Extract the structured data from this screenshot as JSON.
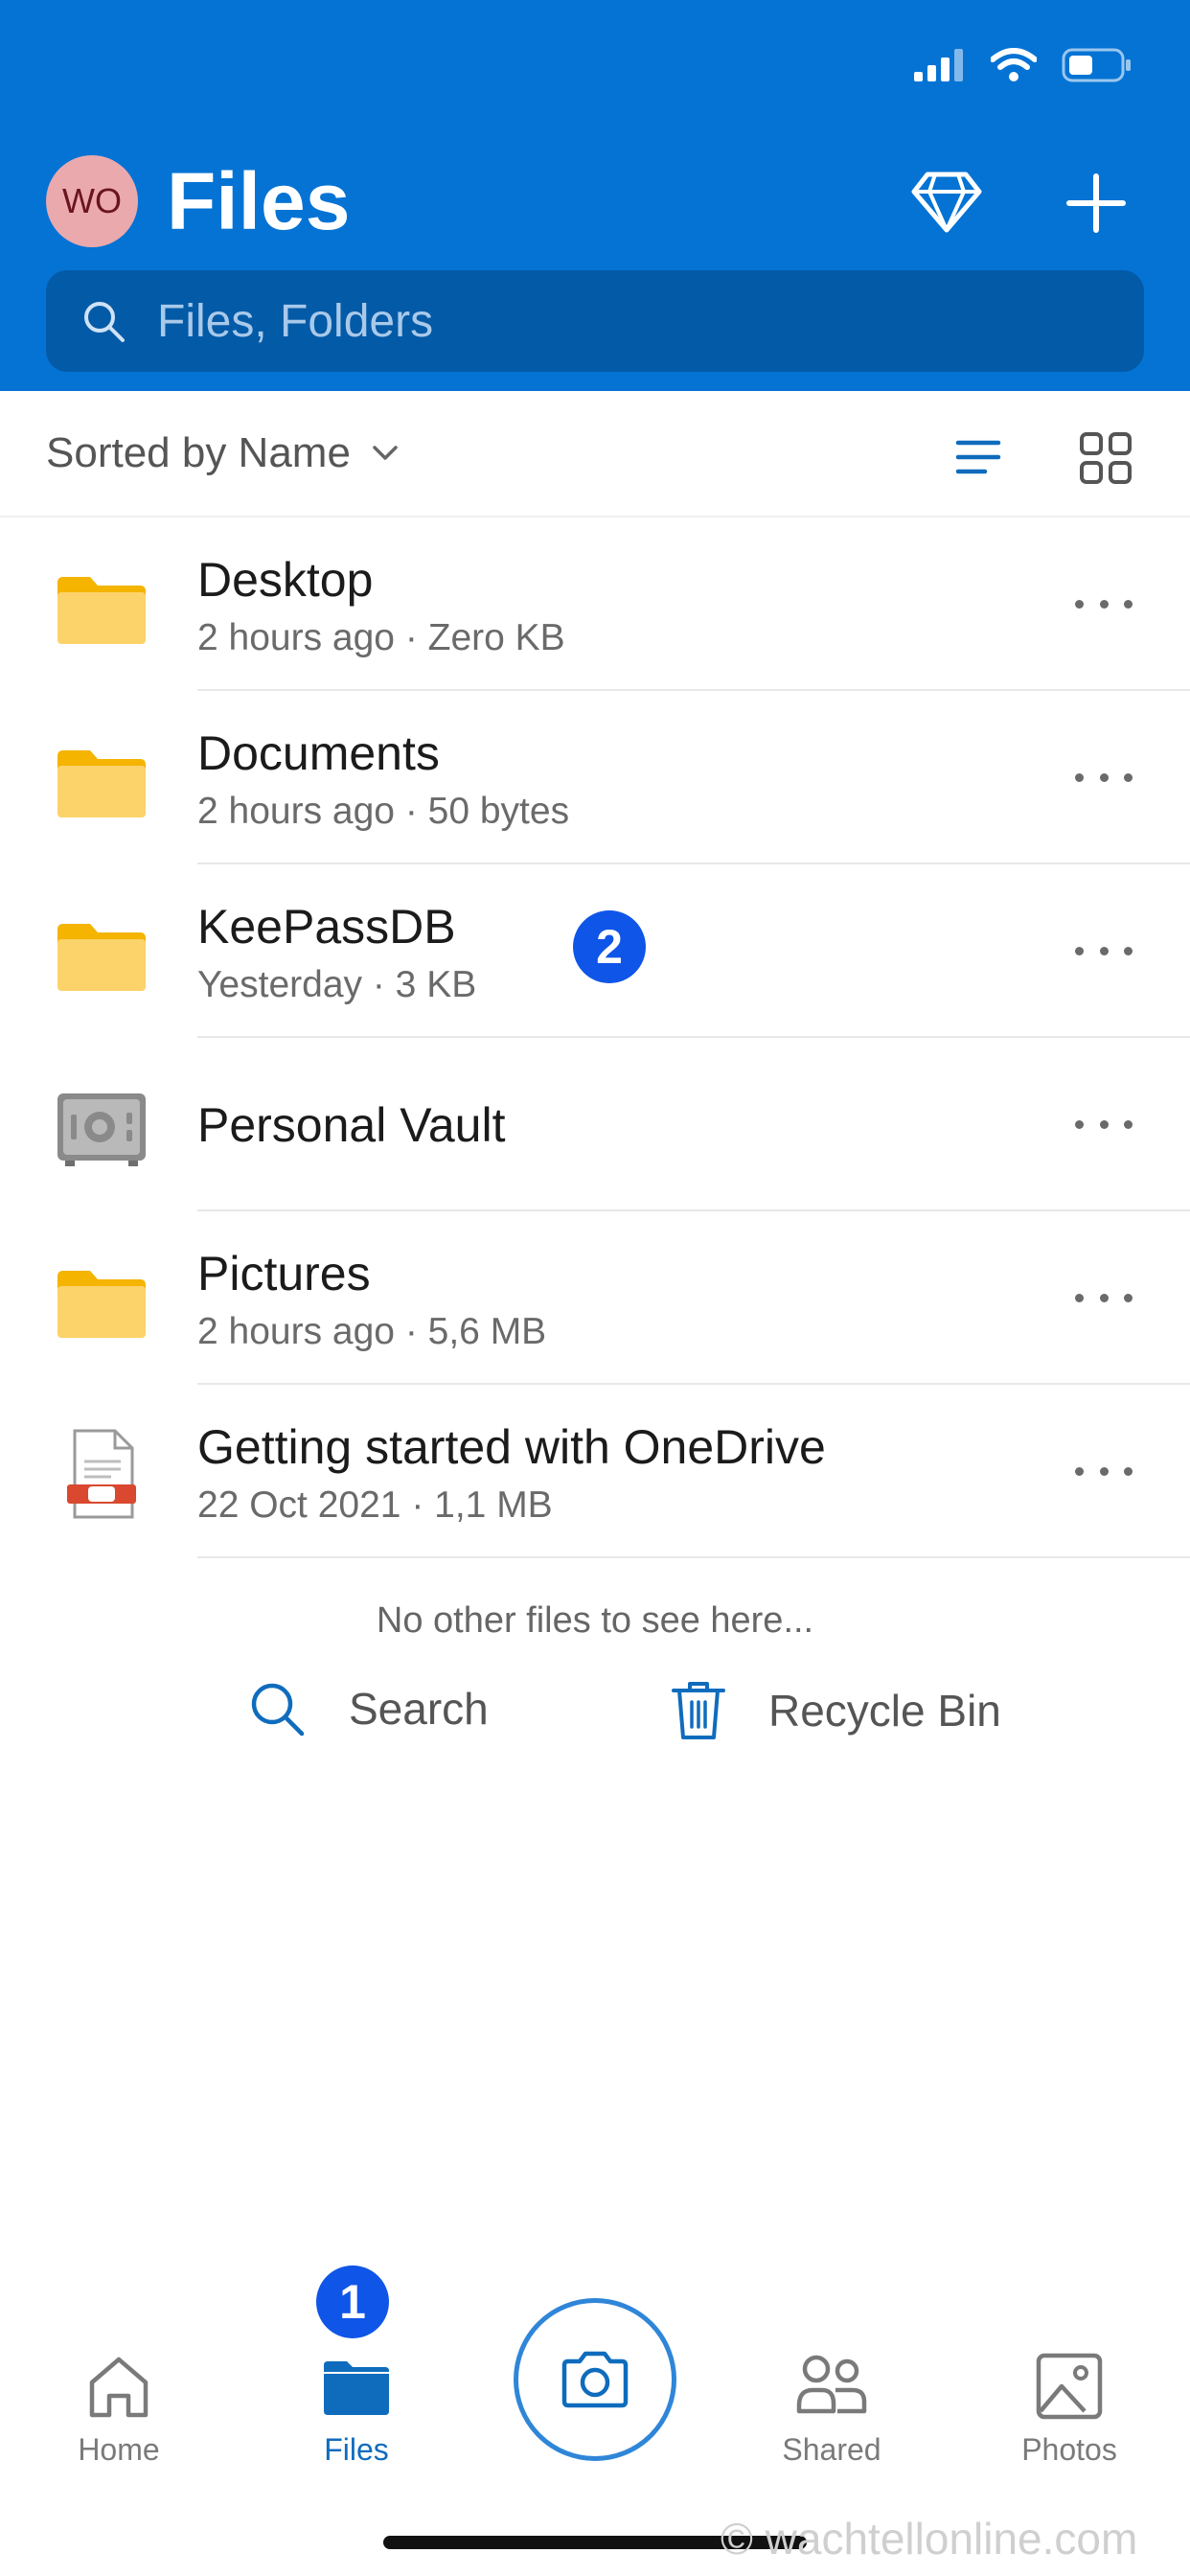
{
  "status_bar": {
    "icons": [
      "signal-icon",
      "wifi-icon",
      "battery-icon"
    ]
  },
  "header": {
    "avatar_initials": "WO",
    "title": "Files",
    "premium_icon": "diamond-icon",
    "add_icon": "plus-icon"
  },
  "search": {
    "placeholder": "Files, Folders"
  },
  "sort": {
    "label": "Sorted by Name"
  },
  "files": [
    {
      "name": "Desktop",
      "meta": "2 hours ago · Zero KB",
      "type": "folder"
    },
    {
      "name": "Documents",
      "meta": "2 hours ago · 50 bytes",
      "type": "folder"
    },
    {
      "name": "KeePassDB",
      "meta": "Yesterday · 3 KB",
      "type": "folder"
    },
    {
      "name": "Personal Vault",
      "meta": "",
      "type": "vault"
    },
    {
      "name": "Pictures",
      "meta": "2 hours ago · 5,6 MB",
      "type": "folder"
    },
    {
      "name": "Getting started with OneDrive",
      "meta": "22 Oct 2021 · 1,1 MB",
      "type": "pdf"
    }
  ],
  "empty_note": "No other files to see here...",
  "footer": {
    "search_label": "Search",
    "recycle_label": "Recycle Bin"
  },
  "annotations": {
    "step1": "1",
    "step2": "2"
  },
  "tabs": [
    {
      "label": "Home",
      "active": false
    },
    {
      "label": "Files",
      "active": true
    },
    {
      "label": "Shared",
      "active": false
    },
    {
      "label": "Photos",
      "active": false
    }
  ],
  "watermark": "© wachtellonline.com",
  "colors": {
    "header_bg": "#0473d4",
    "search_bg": "#035aa7",
    "accent": "#0f6cbd",
    "folder": "#fcd26a",
    "badge": "#0f55e8"
  }
}
